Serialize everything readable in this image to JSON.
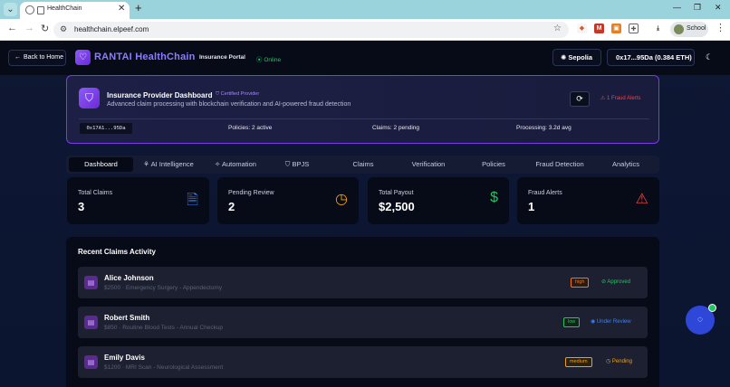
{
  "browser": {
    "tab_title": "HealthChain",
    "url": "healthchain.elpeef.com",
    "profile_label": "School"
  },
  "header": {
    "back_label": "Back to Home",
    "brand": "RANTAI HealthChain",
    "portal_label": "Insurance Portal",
    "online_label": "Online",
    "network": "Sepolia",
    "wallet": "0x17...95Da (0.384 ETH)"
  },
  "provider": {
    "title": "Insurance Provider Dashboard",
    "certified": "Certified Provider",
    "subtitle": "Advanced claim processing with blockchain verification and AI-powered fraud detection",
    "fraud_alerts": "1 Fraud Alerts",
    "address": "0x17A1...95Da",
    "policies": "Policies: 2 active",
    "claims": "Claims: 2 pending",
    "processing": "Processing: 3.2d avg"
  },
  "tabs": [
    {
      "label": "Dashboard"
    },
    {
      "label": "AI Intelligence"
    },
    {
      "label": "Automation"
    },
    {
      "label": "BPJS"
    },
    {
      "label": "Claims"
    },
    {
      "label": "Verification"
    },
    {
      "label": "Policies"
    },
    {
      "label": "Fraud Detection"
    },
    {
      "label": "Analytics"
    }
  ],
  "stats": [
    {
      "label": "Total Claims",
      "value": "3"
    },
    {
      "label": "Pending Review",
      "value": "2"
    },
    {
      "label": "Total Payout",
      "value": "$2,500"
    },
    {
      "label": "Fraud Alerts",
      "value": "1"
    }
  ],
  "recent": {
    "title": "Recent Claims Activity",
    "rows": [
      {
        "name": "Alice Johnson",
        "detail": "$2500 · Emergency Surgery - Appendectomy",
        "risk": "high",
        "status": "Approved"
      },
      {
        "name": "Robert Smith",
        "detail": "$850 · Routine Blood Tests - Annual Checkup",
        "risk": "low",
        "status": "Under Review"
      },
      {
        "name": "Emily Davis",
        "detail": "$1200 · MRI Scan - Neurological Assessment",
        "risk": "medium",
        "status": "Pending"
      }
    ]
  },
  "colors": {
    "accent": "#7c3aed",
    "approved": "#22c55e",
    "review": "#3b82f6",
    "pending": "#f59e0b",
    "danger": "#ef4444"
  }
}
